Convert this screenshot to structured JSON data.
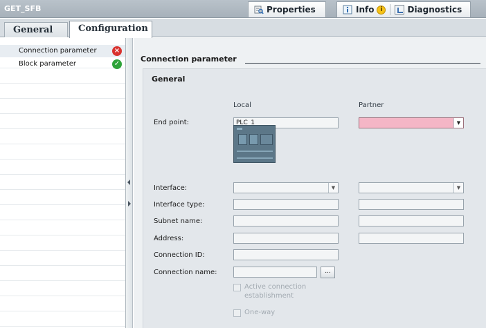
{
  "window": {
    "title": "GET_SFB"
  },
  "inspector_tabs": {
    "properties": "Properties",
    "info": "Info",
    "diagnostics": "Diagnostics"
  },
  "tabs": {
    "general": "General",
    "configuration": "Configuration"
  },
  "nav": {
    "items": [
      {
        "label": "Connection parameter",
        "status": "error"
      },
      {
        "label": "Block parameter",
        "status": "ok"
      }
    ]
  },
  "main": {
    "section_title": "Connection parameter",
    "group_title": "General",
    "columns": {
      "local": "Local",
      "partner": "Partner"
    },
    "rows": {
      "end_point": {
        "label": "End point:",
        "local": "PLC_1",
        "partner": ""
      },
      "interface": {
        "label": "Interface:",
        "local": "",
        "partner": ""
      },
      "interface_type": {
        "label": "Interface type:",
        "local": "",
        "partner": ""
      },
      "subnet_name": {
        "label": "Subnet name:",
        "local": "",
        "partner": ""
      },
      "address": {
        "label": "Address:",
        "local": "",
        "partner": ""
      },
      "connection_id": {
        "label": "Connection ID:",
        "local": ""
      },
      "connection_name": {
        "label": "Connection name:",
        "local": "",
        "browse": "..."
      }
    },
    "checkboxes": {
      "active_connection": "Active connection establishment",
      "one_way": "One-way"
    }
  },
  "colors": {
    "titlebar": "#a7b1ba",
    "partner_endpoint": "#f4b6c6",
    "status_error": "#d9332f",
    "status_ok": "#2fa33a"
  }
}
